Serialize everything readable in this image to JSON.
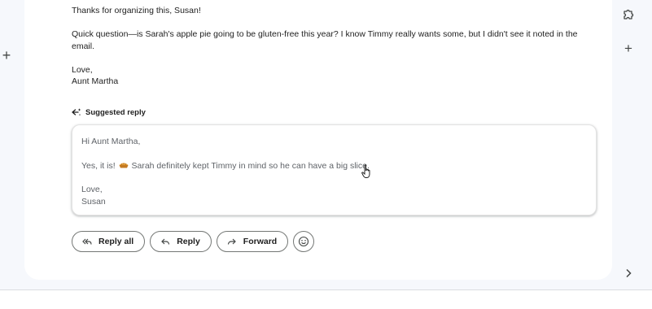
{
  "email": {
    "lines": [
      "Thanks for organizing this, Susan!",
      "Quick question—is Sarah's apple pie going to be gluten-free this year? I know Timmy really wants some, but I didn't see it noted in the email.",
      "Love,",
      "Aunt Martha"
    ]
  },
  "suggested_reply": {
    "label": "Suggested reply",
    "greeting": "Hi Aunt Martha,",
    "body_before_emoji": "Yes, it is!",
    "emoji_icon": "pie-icon",
    "body_after_emoji": "Sarah definitely kept Timmy in mind so he can have a big slice.",
    "signoff": "Love,",
    "signature": "Susan"
  },
  "actions": {
    "reply_all": "Reply all",
    "reply": "Reply",
    "forward": "Forward"
  },
  "icons": {
    "right_rail": [
      "puzzle-icon",
      "plus-icon",
      "chevron-right-icon"
    ],
    "left_rail": [
      "plus-icon"
    ]
  },
  "colors": {
    "background": "#f6f8fc",
    "card": "#ffffff",
    "text": "#1f1f1f",
    "muted_text": "#5f6368",
    "border": "#747775"
  }
}
